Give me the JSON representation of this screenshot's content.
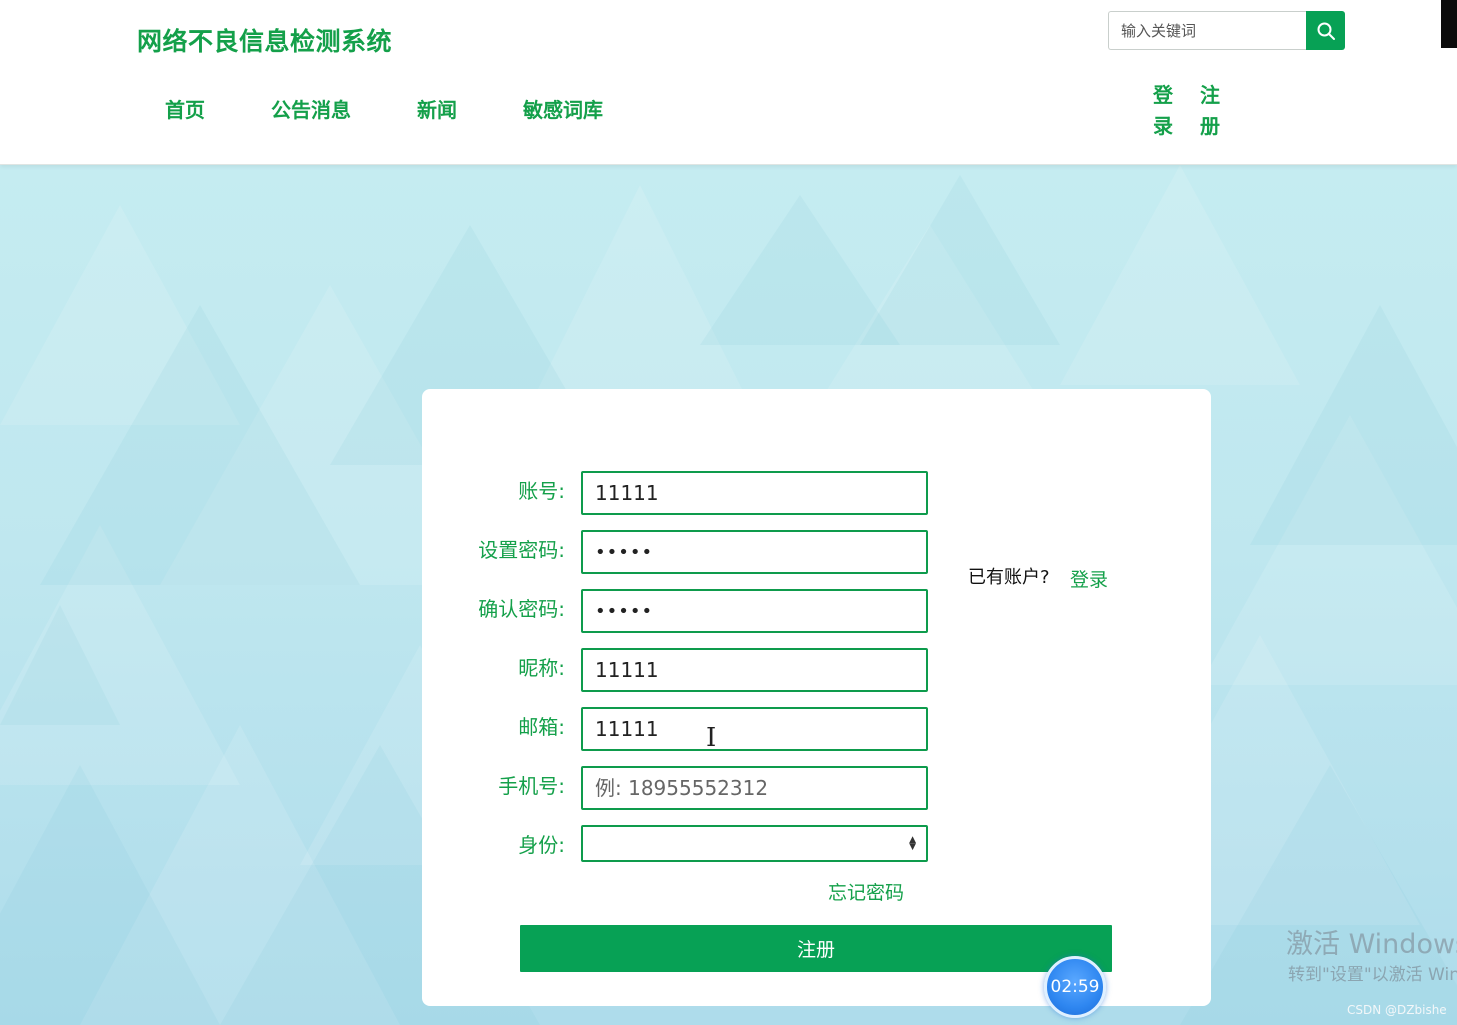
{
  "header": {
    "site_title": "网络不良信息检测系统",
    "search_placeholder": "输入关键词",
    "nav": [
      "首页",
      "公告消息",
      "新闻",
      "敏感词库"
    ],
    "login": "登录",
    "register": "注册"
  },
  "form": {
    "account_label": "账号:",
    "account_value": "11111",
    "password_label": "设置密码:",
    "password_value": "11111",
    "confirm_label": "确认密码:",
    "confirm_value": "11111",
    "nickname_label": "昵称:",
    "nickname_value": "11111",
    "email_label": "邮箱:",
    "email_value": "11111",
    "phone_label": "手机号:",
    "phone_placeholder": "例: 18955552312",
    "role_label": "身份:",
    "have_account": "已有账户?",
    "login_link": "登录",
    "forgot": "忘记密码",
    "submit": "注册"
  },
  "overlay": {
    "timer": "02:59",
    "watermark_title": "激活 Windows",
    "watermark_sub": "转到\"设置\"以激活 Windows。",
    "credit": "CSDN @DZbishe"
  },
  "colors": {
    "accent": "#07a155",
    "text_green": "#14a04a"
  }
}
